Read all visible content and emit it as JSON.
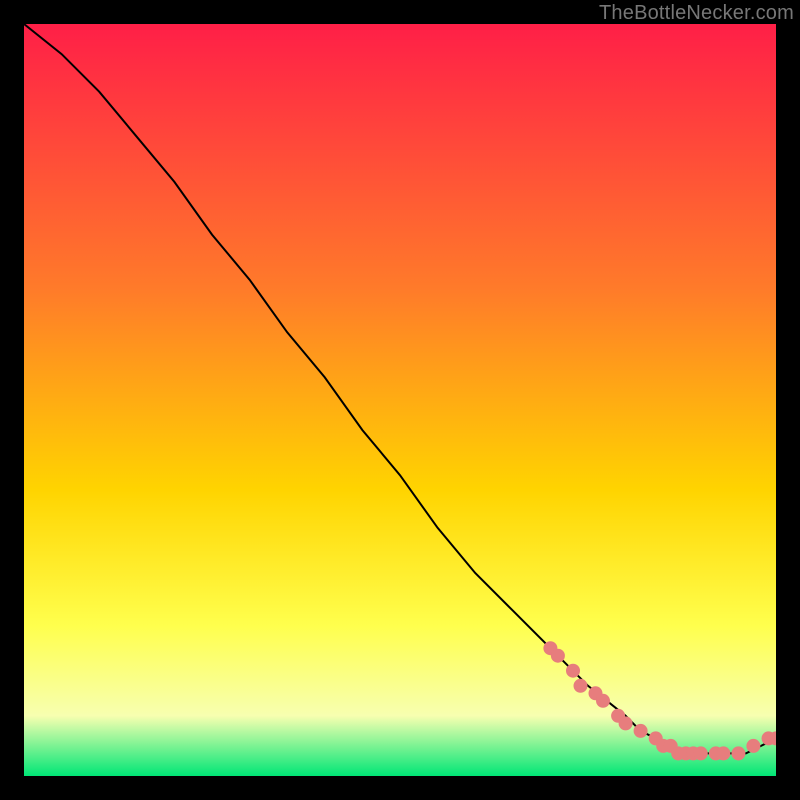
{
  "watermark": "TheBottleNecker.com",
  "colors": {
    "gradient_top": "#ff1f47",
    "gradient_mid1": "#ff7a2a",
    "gradient_mid2": "#ffd400",
    "gradient_mid3": "#ffff4d",
    "gradient_mid4": "#f7ffb0",
    "gradient_bottom": "#00e676",
    "line": "#000000",
    "marker": "#e77d7d",
    "background": "#000000"
  },
  "chart_data": {
    "type": "line",
    "title": "",
    "xlabel": "",
    "ylabel": "",
    "xlim": [
      0,
      100
    ],
    "ylim": [
      0,
      100
    ],
    "grid": false,
    "legend": "none",
    "series": [
      {
        "name": "curve",
        "x": [
          0,
          5,
          10,
          15,
          20,
          25,
          30,
          35,
          40,
          45,
          50,
          55,
          60,
          65,
          70,
          75,
          80,
          82,
          84,
          86,
          88,
          90,
          92,
          94,
          96,
          98,
          100
        ],
        "y": [
          100,
          96,
          91,
          85,
          79,
          72,
          66,
          59,
          53,
          46,
          40,
          33,
          27,
          22,
          17,
          12,
          8,
          6,
          5,
          4,
          3,
          3,
          3,
          3,
          3,
          4,
          5
        ]
      }
    ],
    "markers": [
      {
        "x": 70,
        "y": 17
      },
      {
        "x": 71,
        "y": 16
      },
      {
        "x": 73,
        "y": 14
      },
      {
        "x": 74,
        "y": 12
      },
      {
        "x": 76,
        "y": 11
      },
      {
        "x": 77,
        "y": 10
      },
      {
        "x": 79,
        "y": 8
      },
      {
        "x": 80,
        "y": 7
      },
      {
        "x": 82,
        "y": 6
      },
      {
        "x": 84,
        "y": 5
      },
      {
        "x": 85,
        "y": 4
      },
      {
        "x": 86,
        "y": 4
      },
      {
        "x": 87,
        "y": 3
      },
      {
        "x": 88,
        "y": 3
      },
      {
        "x": 89,
        "y": 3
      },
      {
        "x": 90,
        "y": 3
      },
      {
        "x": 92,
        "y": 3
      },
      {
        "x": 93,
        "y": 3
      },
      {
        "x": 95,
        "y": 3
      },
      {
        "x": 97,
        "y": 4
      },
      {
        "x": 99,
        "y": 5
      },
      {
        "x": 100,
        "y": 5
      }
    ]
  }
}
